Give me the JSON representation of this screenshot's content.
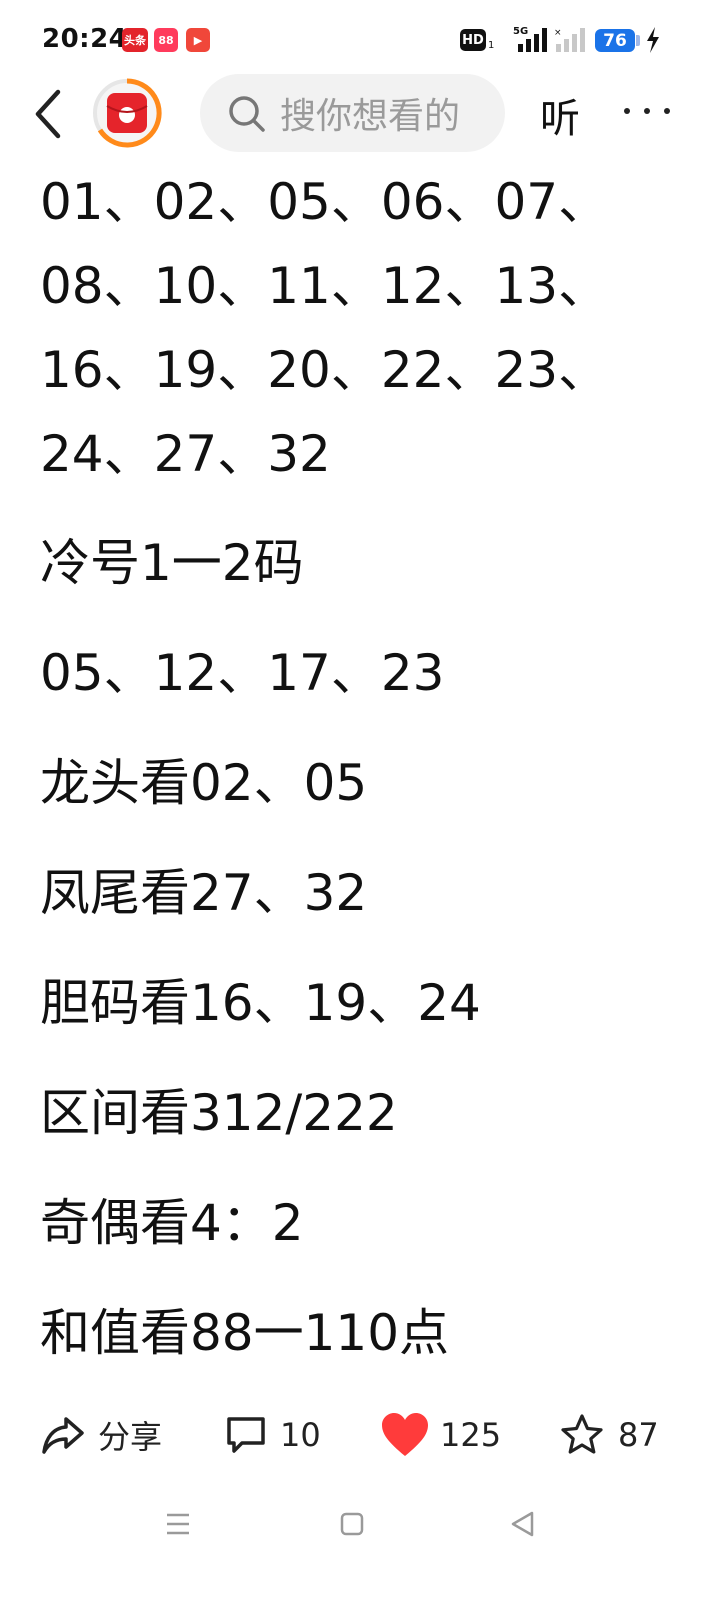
{
  "status": {
    "time": "20:24",
    "badges": [
      "头条",
      "88",
      "▶"
    ],
    "hd": "HD",
    "hd_sub": "1",
    "network": "5G",
    "battery": "76"
  },
  "topbar": {
    "search_placeholder": "搜你想看的",
    "listen_label": "听"
  },
  "article": {
    "numbers_lines": [
      "01、02、05、06、07、",
      "08、10、11、12、13、",
      "16、19、20、22、23、",
      "24、27、32"
    ],
    "lines": [
      "冷号1一2码",
      "05、12、17、23",
      "龙头看02、05",
      "凤尾看27、32",
      "胆码看16、19、24",
      "区间看312/222",
      "奇偶看4：2",
      "和值看88一110点"
    ]
  },
  "actions": {
    "share_label": "分享",
    "comment_count": "10",
    "like_count": "125",
    "favorite_count": "87"
  },
  "colors": {
    "accent_red": "#ff3b3b",
    "search_bg": "#f2f2f2",
    "battery_blue": "#1a73e8"
  }
}
